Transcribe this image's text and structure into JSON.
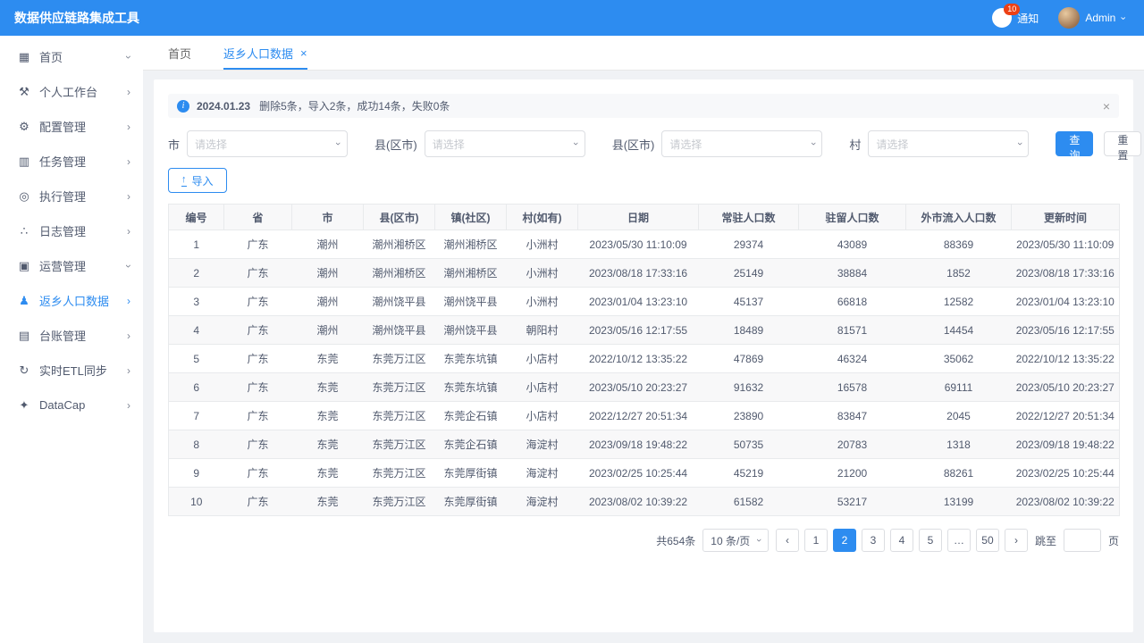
{
  "header": {
    "title": "数据供应链路集成工具",
    "notification": {
      "label": "通知",
      "badge": "10"
    },
    "user": {
      "name": "Admin"
    }
  },
  "sidebar": {
    "items": [
      {
        "key": "home",
        "label": "首页",
        "icon": "grid-icon",
        "glyph": "▦",
        "chevron": "down",
        "active": false
      },
      {
        "key": "workbench",
        "label": "个人工作台",
        "icon": "wrench-icon",
        "glyph": "⚒",
        "chevron": "right",
        "active": false
      },
      {
        "key": "config",
        "label": "配置管理",
        "icon": "gear-icon",
        "glyph": "⚙",
        "chevron": "right",
        "active": false
      },
      {
        "key": "tasks",
        "label": "任务管理",
        "icon": "bar-chart-icon",
        "glyph": "▥",
        "chevron": "right",
        "active": false
      },
      {
        "key": "execution",
        "label": "执行管理",
        "icon": "magnifier-icon",
        "glyph": "◎",
        "chevron": "right",
        "active": false
      },
      {
        "key": "logs",
        "label": "日志管理",
        "icon": "share-nodes-icon",
        "glyph": "∴",
        "chevron": "right",
        "active": false
      },
      {
        "key": "operations",
        "label": "运营管理",
        "icon": "monitor-icon",
        "glyph": "▣",
        "chevron": "down",
        "active": false
      },
      {
        "key": "population",
        "label": "返乡人口数据",
        "icon": "people-icon",
        "glyph": "♟",
        "chevron": "right",
        "active": true
      },
      {
        "key": "ledger",
        "label": "台账管理",
        "icon": "book-icon",
        "glyph": "▤",
        "chevron": "right",
        "active": false
      },
      {
        "key": "etl",
        "label": "实时ETL同步",
        "icon": "sync-icon",
        "glyph": "↻",
        "chevron": "right",
        "active": false
      },
      {
        "key": "datacap",
        "label": "DataCap",
        "icon": "plug-icon",
        "glyph": "✦",
        "chevron": "right",
        "active": false
      }
    ]
  },
  "tabs": [
    {
      "key": "home",
      "label": "首页",
      "active": false,
      "closable": false
    },
    {
      "key": "population-data",
      "label": "返乡人口数据",
      "active": true,
      "closable": true
    }
  ],
  "alert": {
    "date": "2024.01.23",
    "message": "删除5条，导入2条，成功14条，失败0条"
  },
  "filters": [
    {
      "label": "市",
      "placeholder": "请选择"
    },
    {
      "label": "县(区市)",
      "placeholder": "请选择"
    },
    {
      "label": "县(区市)",
      "placeholder": "请选择"
    },
    {
      "label": "村",
      "placeholder": "请选择"
    }
  ],
  "actions": {
    "search": "查询",
    "reset": "重置",
    "import": "导入"
  },
  "table": {
    "columns": [
      "编号",
      "省",
      "市",
      "县(区市)",
      "镇(社区)",
      "村(如有)",
      "日期",
      "常驻人口数",
      "驻留人口数",
      "外市流入人口数",
      "更新时间"
    ],
    "rows": [
      [
        "1",
        "广东",
        "潮州",
        "潮州湘桥区",
        "潮州湘桥区",
        "小洲村",
        "2023/05/30 11:10:09",
        "29374",
        "43089",
        "88369",
        "2023/05/30 11:10:09"
      ],
      [
        "2",
        "广东",
        "潮州",
        "潮州湘桥区",
        "潮州湘桥区",
        "小洲村",
        "2023/08/18 17:33:16",
        "25149",
        "38884",
        "1852",
        "2023/08/18 17:33:16"
      ],
      [
        "3",
        "广东",
        "潮州",
        "潮州饶平县",
        "潮州饶平县",
        "小洲村",
        "2023/01/04 13:23:10",
        "45137",
        "66818",
        "12582",
        "2023/01/04 13:23:10"
      ],
      [
        "4",
        "广东",
        "潮州",
        "潮州饶平县",
        "潮州饶平县",
        "朝阳村",
        "2023/05/16 12:17:55",
        "18489",
        "81571",
        "14454",
        "2023/05/16 12:17:55"
      ],
      [
        "5",
        "广东",
        "东莞",
        "东莞万江区",
        "东莞东坑镇",
        "小店村",
        "2022/10/12 13:35:22",
        "47869",
        "46324",
        "35062",
        "2022/10/12 13:35:22"
      ],
      [
        "6",
        "广东",
        "东莞",
        "东莞万江区",
        "东莞东坑镇",
        "小店村",
        "2023/05/10 20:23:27",
        "91632",
        "16578",
        "69111",
        "2023/05/10 20:23:27"
      ],
      [
        "7",
        "广东",
        "东莞",
        "东莞万江区",
        "东莞企石镇",
        "小店村",
        "2022/12/27 20:51:34",
        "23890",
        "83847",
        "2045",
        "2022/12/27 20:51:34"
      ],
      [
        "8",
        "广东",
        "东莞",
        "东莞万江区",
        "东莞企石镇",
        "海淀村",
        "2023/09/18 19:48:22",
        "50735",
        "20783",
        "1318",
        "2023/09/18 19:48:22"
      ],
      [
        "9",
        "广东",
        "东莞",
        "东莞万江区",
        "东莞厚街镇",
        "海淀村",
        "2023/02/25 10:25:44",
        "45219",
        "21200",
        "88261",
        "2023/02/25 10:25:44"
      ],
      [
        "10",
        "广东",
        "东莞",
        "东莞万江区",
        "东莞厚街镇",
        "海淀村",
        "2023/08/02 10:39:22",
        "61582",
        "53217",
        "13199",
        "2023/08/02 10:39:22"
      ]
    ]
  },
  "pagination": {
    "total": "共654条",
    "page_size": "10 条/页",
    "pages": [
      "1",
      "2",
      "3",
      "4",
      "5",
      "…",
      "50"
    ],
    "active_page": "2",
    "jump_label": "跳至",
    "page_unit": "页"
  },
  "colors": {
    "primary": "#2d8cf0",
    "badge": "#ed4014",
    "header_bg": "#2d8cf0"
  }
}
